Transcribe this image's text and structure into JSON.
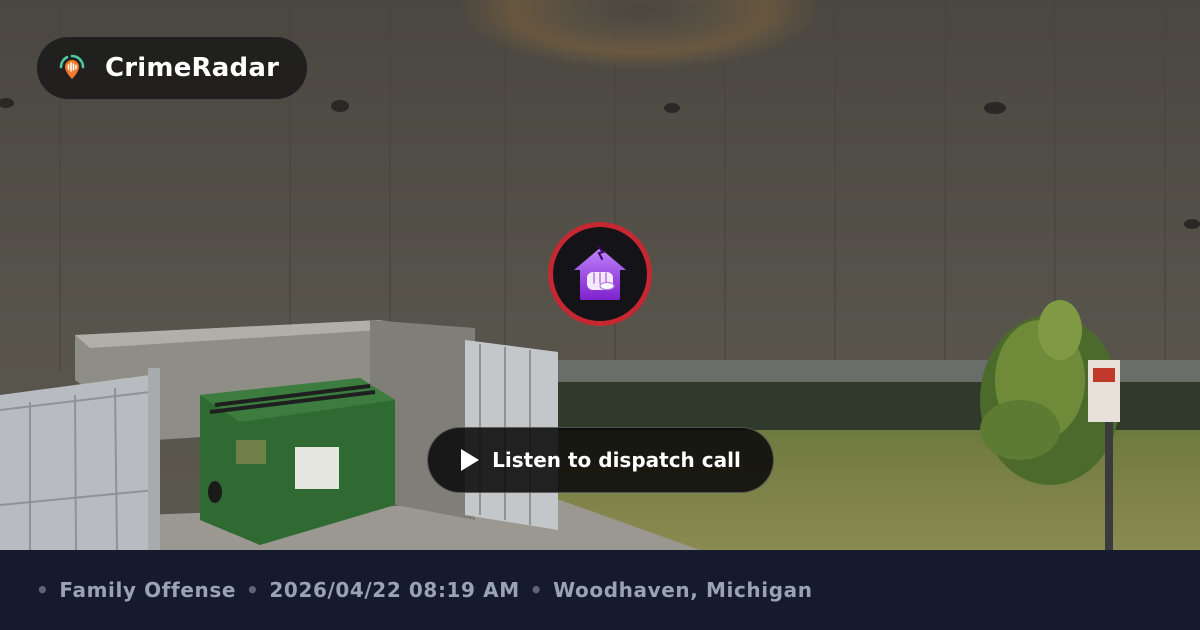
{
  "brand": {
    "name": "CrimeRadar",
    "logo_icon": "radar-pin-icon",
    "logo_colors": {
      "pin": "#f07a28",
      "ring": "#4cc9a4",
      "bars": "#ffffff"
    }
  },
  "marker": {
    "icon": "family-offense-fist-house-icon",
    "ring_color": "#c62832",
    "icon_color": "#a855f7"
  },
  "listen_button": {
    "label": "Listen to dispatch call",
    "icon": "play-icon"
  },
  "incident": {
    "category": "Family Offense",
    "datetime": "2026/04/22 08:19 AM",
    "location": "Woodhaven, Michigan",
    "separator": "•"
  },
  "background": {
    "description_type": "street-view-photo",
    "footer_color": "#151b2c"
  }
}
